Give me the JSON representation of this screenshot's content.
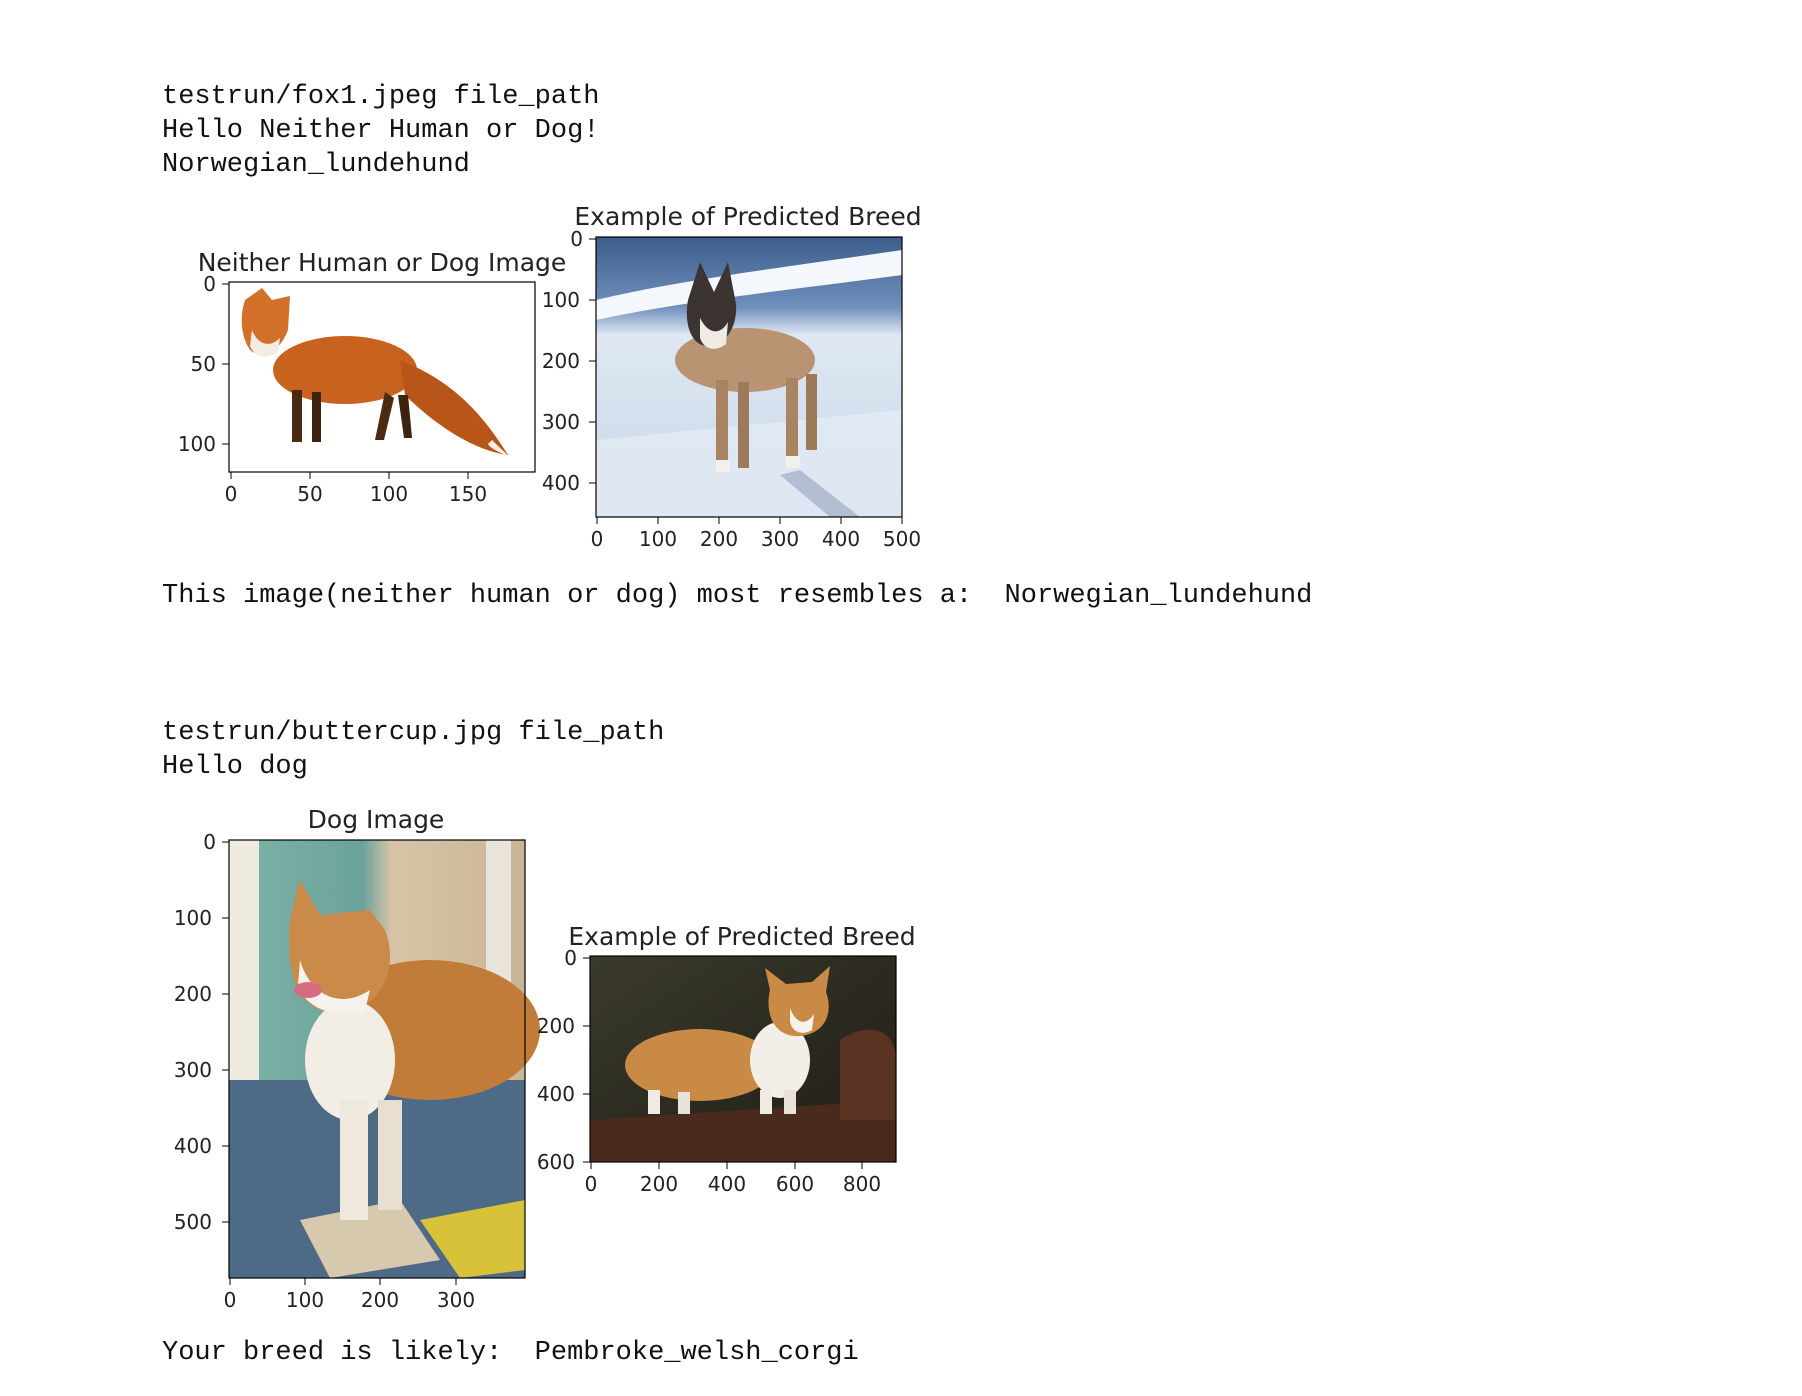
{
  "colors": {
    "text": "#111111",
    "axis": "#000000",
    "background": "#ffffff"
  },
  "output_blocks": [
    {
      "lines": [
        "testrun/fox1.jpeg file_path",
        "Hello Neither Human or Dog!",
        "Norwegian_lundehund"
      ],
      "figures": [
        {
          "title": "Neither Human or Dog Image",
          "image": "fox",
          "xticks": [
            "0",
            "50",
            "100",
            "150"
          ],
          "yticks": [
            "0",
            "50",
            "100"
          ]
        },
        {
          "title": "Example of Predicted Breed",
          "image": "norwegian-lundehund-dog-in-snow",
          "xticks": [
            "0",
            "100",
            "200",
            "300",
            "400",
            "500"
          ],
          "yticks": [
            "0",
            "100",
            "200",
            "300",
            "400"
          ]
        }
      ],
      "result": "This image(neither human or dog) most resembles a:  Norwegian_lundehund"
    },
    {
      "lines": [
        "testrun/buttercup.jpg file_path",
        "Hello dog"
      ],
      "figures": [
        {
          "title": "Dog Image",
          "image": "buttercup-dog-photo",
          "xticks": [
            "0",
            "100",
            "200",
            "300"
          ],
          "yticks": [
            "0",
            "100",
            "200",
            "300",
            "400",
            "500"
          ]
        },
        {
          "title": "Example of Predicted Breed",
          "image": "pembroke-welsh-corgi",
          "xticks": [
            "0",
            "200",
            "400",
            "600",
            "800"
          ],
          "yticks": [
            "0",
            "200",
            "400",
            "600"
          ]
        }
      ],
      "result": "Your breed is likely:  Pembroke_welsh_corgi"
    }
  ]
}
